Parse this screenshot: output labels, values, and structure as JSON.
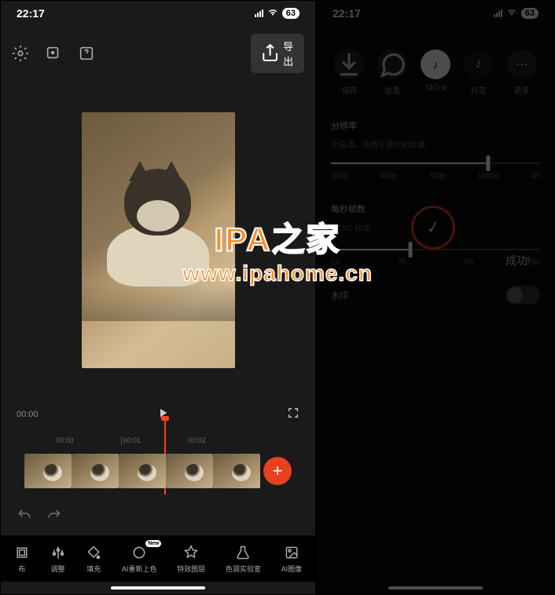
{
  "status": {
    "time": "22:17",
    "battery": "63"
  },
  "left": {
    "export_label": "导出",
    "time_start": "00:00",
    "ruler": [
      "00:00",
      "00:01",
      "00:02"
    ],
    "tools": [
      {
        "label": "布",
        "icon": "crop"
      },
      {
        "label": "调整",
        "icon": "adjust"
      },
      {
        "label": "填充",
        "icon": "fill"
      },
      {
        "label": "AI重新上色",
        "icon": "recolor",
        "badge": "New"
      },
      {
        "label": "特效图层",
        "icon": "fx"
      },
      {
        "label": "色调实验室",
        "icon": "lab"
      },
      {
        "label": "AI图像",
        "icon": "aiimg"
      }
    ]
  },
  "right": {
    "share": [
      {
        "label": "保存",
        "key": "save"
      },
      {
        "label": "信息",
        "key": "msg"
      },
      {
        "label": "TikTok",
        "key": "tiktok"
      },
      {
        "label": "抖音",
        "key": "douyin"
      },
      {
        "label": "更多",
        "key": "more"
      }
    ],
    "resolution": {
      "label": "分辨率",
      "desc": "全高清。适用于更大的屏幕。",
      "options": [
        "360p",
        "480p",
        "720p",
        "1080p",
        "4K"
      ]
    },
    "fps": {
      "label": "每秒帧数",
      "desc": "NTSC 标准",
      "options": [
        "24",
        "25",
        "50",
        "60"
      ]
    },
    "success": "成功!",
    "watermark_label": "水印"
  },
  "watermark": {
    "title": "IPA之家",
    "url": "www.ipahome.cn"
  }
}
